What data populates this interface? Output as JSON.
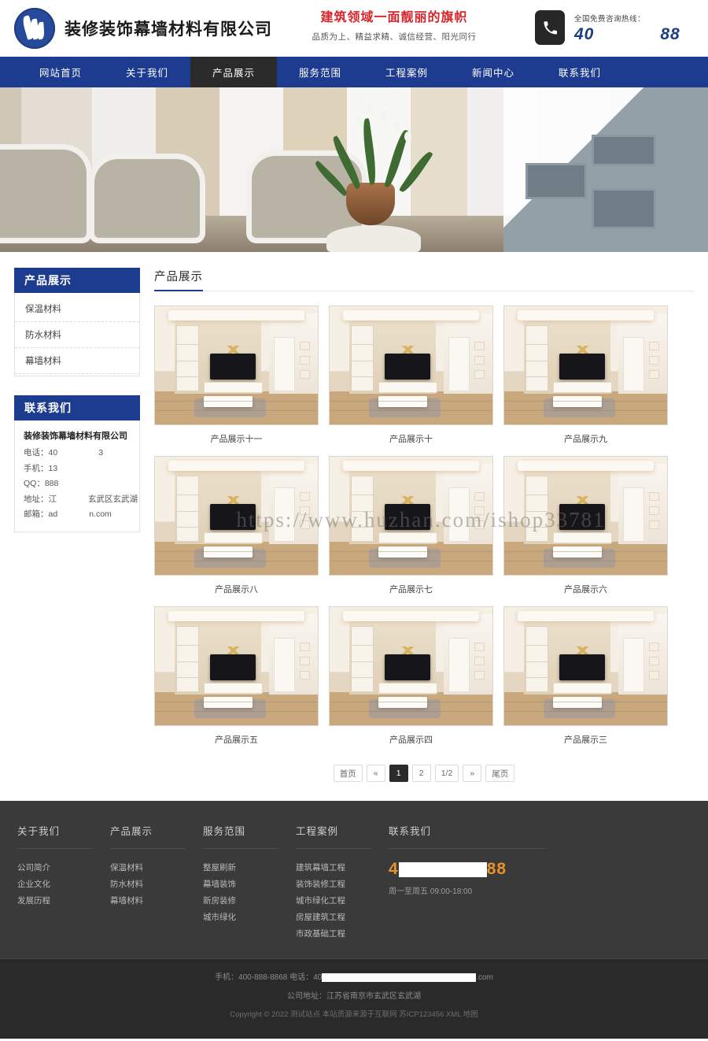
{
  "header": {
    "logo_icon": "flame-circle-logo",
    "brand_name": "装修装饰幕墙材料有限公司",
    "slogan_main": "建筑领域一面靓丽的旗帜",
    "slogan_sub": "品质为上、精益求精、诚信经营、阳光同行",
    "phone_icon": "phone-handset-icon",
    "hotline_label": "全国免费咨询热线：",
    "hotline_prefix": "40",
    "hotline_suffix": "88",
    "accent_color": "#1d3c8f",
    "slogan_color": "#d7262a"
  },
  "nav": {
    "items": [
      {
        "label": "网站首页",
        "active": false
      },
      {
        "label": "关于我们",
        "active": false
      },
      {
        "label": "产品展示",
        "active": true
      },
      {
        "label": "服务范围",
        "active": false
      },
      {
        "label": "工程案例",
        "active": false
      },
      {
        "label": "新闻中心",
        "active": false
      },
      {
        "label": "联系我们",
        "active": false
      }
    ],
    "active_bg": "#2b2b2b"
  },
  "hero": {
    "alt": "interior-living-room-banner"
  },
  "sidebar": {
    "products_panel": {
      "title": "产品展示",
      "items": [
        {
          "label": "保温材料"
        },
        {
          "label": "防水材料"
        },
        {
          "label": "幕墙材料"
        }
      ]
    },
    "contact_panel": {
      "title": "联系我们",
      "company": "装修装饰幕墙材料有限公司",
      "rows": [
        {
          "label": "电话：",
          "value_prefix": "40",
          "redacted": true,
          "value_suffix": "3"
        },
        {
          "label": "手机：",
          "value_prefix": "13",
          "redacted": true,
          "value_suffix": ""
        },
        {
          "label": "QQ：",
          "value_prefix": "888",
          "redacted": false,
          "value_suffix": ""
        },
        {
          "label": "地址：",
          "value_prefix": "江",
          "redacted": true,
          "value_suffix": "玄武区玄武湖"
        },
        {
          "label": "邮箱：",
          "value_prefix": "ad",
          "redacted": true,
          "value_suffix": "n.com"
        }
      ]
    }
  },
  "content": {
    "page_title": "产品展示",
    "watermark": "https://www.huzhan.com/ishop33781",
    "products": [
      {
        "caption": "产品展示十一"
      },
      {
        "caption": "产品展示十"
      },
      {
        "caption": "产品展示九"
      },
      {
        "caption": "产品展示八"
      },
      {
        "caption": "产品展示七"
      },
      {
        "caption": "产品展示六"
      },
      {
        "caption": "产品展示五"
      },
      {
        "caption": "产品展示四"
      },
      {
        "caption": "产品展示三"
      }
    ],
    "pagination": [
      {
        "label": "首页",
        "active": false
      },
      {
        "label": "«",
        "active": false
      },
      {
        "label": "1",
        "active": true
      },
      {
        "label": "2",
        "active": false
      },
      {
        "label": "1/2",
        "active": false
      },
      {
        "label": "»",
        "active": false
      },
      {
        "label": "尾页",
        "active": false
      }
    ]
  },
  "footer": {
    "columns": [
      {
        "title": "关于我们",
        "links": [
          "公司简介",
          "企业文化",
          "发展历程"
        ]
      },
      {
        "title": "产品展示",
        "links": [
          "保温材料",
          "防水材料",
          "幕墙材料"
        ]
      },
      {
        "title": "服务范围",
        "links": [
          "整屋刷新",
          "幕墙装饰",
          "新房装修",
          "城市绿化"
        ]
      },
      {
        "title": "工程案例",
        "links": [
          "建筑幕墙工程",
          "装饰装修工程",
          "城市绿化工程",
          "房屋建筑工程",
          "市政基础工程"
        ]
      }
    ],
    "contact": {
      "title": "联系我们",
      "phone_prefix": "4",
      "phone_suffix": "88",
      "phone_color": "#e8912a",
      "hours": "周一至周五 09:00-18:00"
    },
    "bottom": {
      "line1_prefix": "手机：400-888-8868  电话：40",
      "line1_suffix": ".com",
      "line2": "公司地址：江苏省南京市玄武区玄武湖",
      "copyright": "Copyright © 2022 测试站点 本站资源来源于互联网  苏ICP123456 XML 地图"
    }
  }
}
